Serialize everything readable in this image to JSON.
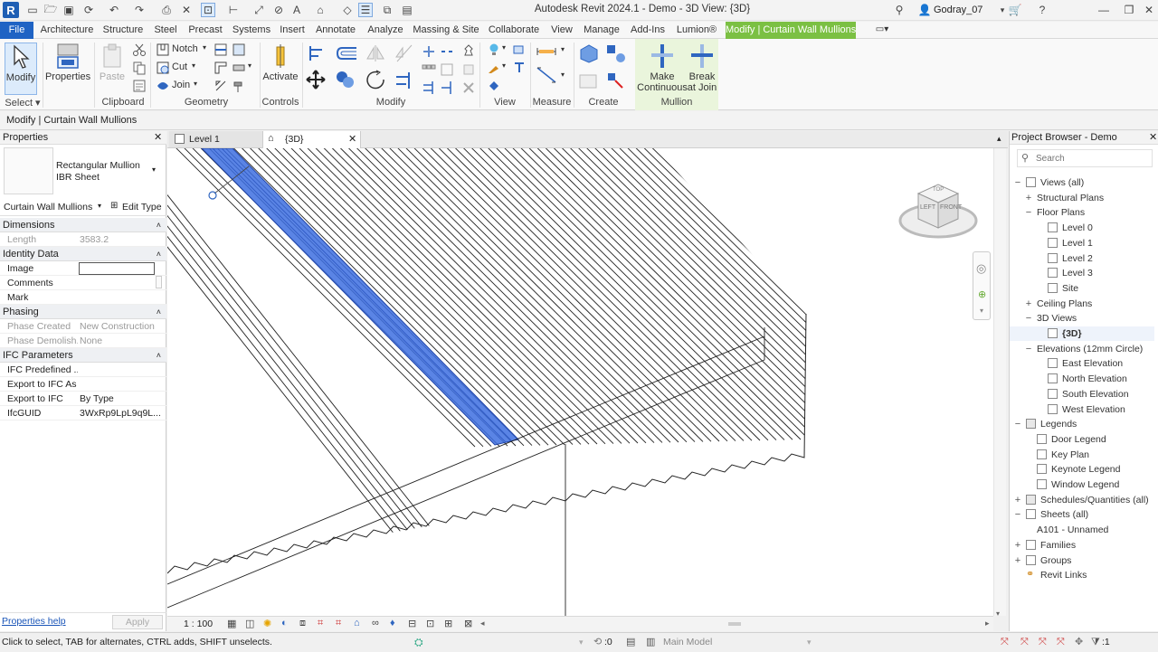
{
  "window": {
    "title": "Autodesk Revit 2024.1 - Demo - 3D View: {3D}",
    "user": "Godray_07"
  },
  "menu_tabs": [
    "File",
    "Architecture",
    "Structure",
    "Steel",
    "Precast",
    "Systems",
    "Insert",
    "Annotate",
    "Analyze",
    "Massing & Site",
    "Collaborate",
    "View",
    "Manage",
    "Add-Ins",
    "Lumion®",
    "Modify | Curtain Wall Mullions"
  ],
  "ribbon": {
    "select_label": "Select",
    "modify_label": "Modify",
    "properties_label": "Properties",
    "clipboard_label": "Clipboard",
    "paste_label": "Paste",
    "notch_label": "Notch",
    "cut_label": "Cut",
    "join_label": "Join",
    "geometry_label": "Geometry",
    "activate_label": "Activate",
    "controls_label": "Controls",
    "modify_panel_label": "Modify",
    "view_label": "View",
    "measure_label": "Measure",
    "create_label": "Create",
    "make_continuous_1": "Make",
    "make_continuous_2": "Continuous",
    "break_at_join_1": "Break",
    "break_at_join_2": "at Join",
    "mullion_label": "Mullion"
  },
  "options_bar": "Modify | Curtain Wall Mullions",
  "properties": {
    "title": "Properties",
    "type_name": "Rectangular Mullion",
    "type_sub": "IBR Sheet",
    "category": "Curtain Wall Mullions",
    "edit_type": "Edit Type",
    "groups": [
      {
        "name": "Dimensions",
        "rows": [
          {
            "k": "Length",
            "v": "3583.2",
            "grey": true
          }
        ]
      },
      {
        "name": "Identity Data",
        "rows": [
          {
            "k": "Image",
            "v": ""
          },
          {
            "k": "Comments",
            "v": ""
          },
          {
            "k": "Mark",
            "v": ""
          }
        ]
      },
      {
        "name": "Phasing",
        "rows": [
          {
            "k": "Phase Created",
            "v": "New Construction",
            "grey": true
          },
          {
            "k": "Phase Demolish...",
            "v": "None",
            "grey": true
          }
        ]
      },
      {
        "name": "IFC Parameters",
        "rows": [
          {
            "k": "IFC Predefined ...",
            "v": ""
          },
          {
            "k": "Export to IFC As",
            "v": ""
          },
          {
            "k": "Export to IFC",
            "v": "By Type"
          },
          {
            "k": "IfcGUID",
            "v": "3WxRp9LpL9q9L..."
          }
        ]
      }
    ],
    "help_link": "Properties help",
    "apply": "Apply"
  },
  "view_tabs": [
    {
      "label": "Level 1"
    },
    {
      "label": "{3D}"
    }
  ],
  "view_scale": "1 : 100",
  "viewcube": {
    "top": "TOP",
    "left": "LEFT",
    "front": "FRONT"
  },
  "browser": {
    "title": "Project Browser - Demo",
    "search_placeholder": "Search",
    "nodes": [
      {
        "label": "Views (all)",
        "depth": 0,
        "ex": "−",
        "icon": "folder"
      },
      {
        "label": "Structural Plans",
        "depth": 1,
        "ex": "+"
      },
      {
        "label": "Floor Plans",
        "depth": 1,
        "ex": "−"
      },
      {
        "label": "Level 0",
        "depth": 2,
        "icon": "view"
      },
      {
        "label": "Level 1",
        "depth": 2,
        "icon": "view"
      },
      {
        "label": "Level 2",
        "depth": 2,
        "icon": "view"
      },
      {
        "label": "Level 3",
        "depth": 2,
        "icon": "view"
      },
      {
        "label": "Site",
        "depth": 2,
        "icon": "view"
      },
      {
        "label": "Ceiling Plans",
        "depth": 1,
        "ex": "+"
      },
      {
        "label": "3D Views",
        "depth": 1,
        "ex": "−"
      },
      {
        "label": "{3D}",
        "depth": 2,
        "icon": "view",
        "bold": true
      },
      {
        "label": "Elevations (12mm Circle)",
        "depth": 1,
        "ex": "−"
      },
      {
        "label": "East Elevation",
        "depth": 2,
        "icon": "view"
      },
      {
        "label": "North Elevation",
        "depth": 2,
        "icon": "view"
      },
      {
        "label": "South Elevation",
        "depth": 2,
        "icon": "view"
      },
      {
        "label": "West Elevation",
        "depth": 2,
        "icon": "view"
      },
      {
        "label": "Legends",
        "depth": 0,
        "ex": "−",
        "icon": "table"
      },
      {
        "label": "Door Legend",
        "depth": 1,
        "icon": "view"
      },
      {
        "label": "Key Plan",
        "depth": 1,
        "icon": "view"
      },
      {
        "label": "Keynote Legend",
        "depth": 1,
        "icon": "view"
      },
      {
        "label": "Window Legend",
        "depth": 1,
        "icon": "view"
      },
      {
        "label": "Schedules/Quantities (all)",
        "depth": 0,
        "ex": "+",
        "icon": "table"
      },
      {
        "label": "Sheets (all)",
        "depth": 0,
        "ex": "−",
        "icon": "sheet"
      },
      {
        "label": "A101 - Unnamed",
        "depth": 1
      },
      {
        "label": "Families",
        "depth": 0,
        "ex": "+",
        "icon": "folder"
      },
      {
        "label": "Groups",
        "depth": 0,
        "ex": "+",
        "icon": "folder"
      },
      {
        "label": "Revit Links",
        "depth": 0,
        "icon": "link"
      }
    ]
  },
  "status": {
    "hint": "Click to select, TAB for alternates, CTRL adds, SHIFT unselects.",
    "workset_count": ":0",
    "model": "Main Model",
    "filter_count": ":1"
  },
  "colors": {
    "accent": "#1f63c4",
    "context_tab": "#7bc043",
    "selection": "#3d6fe0"
  }
}
